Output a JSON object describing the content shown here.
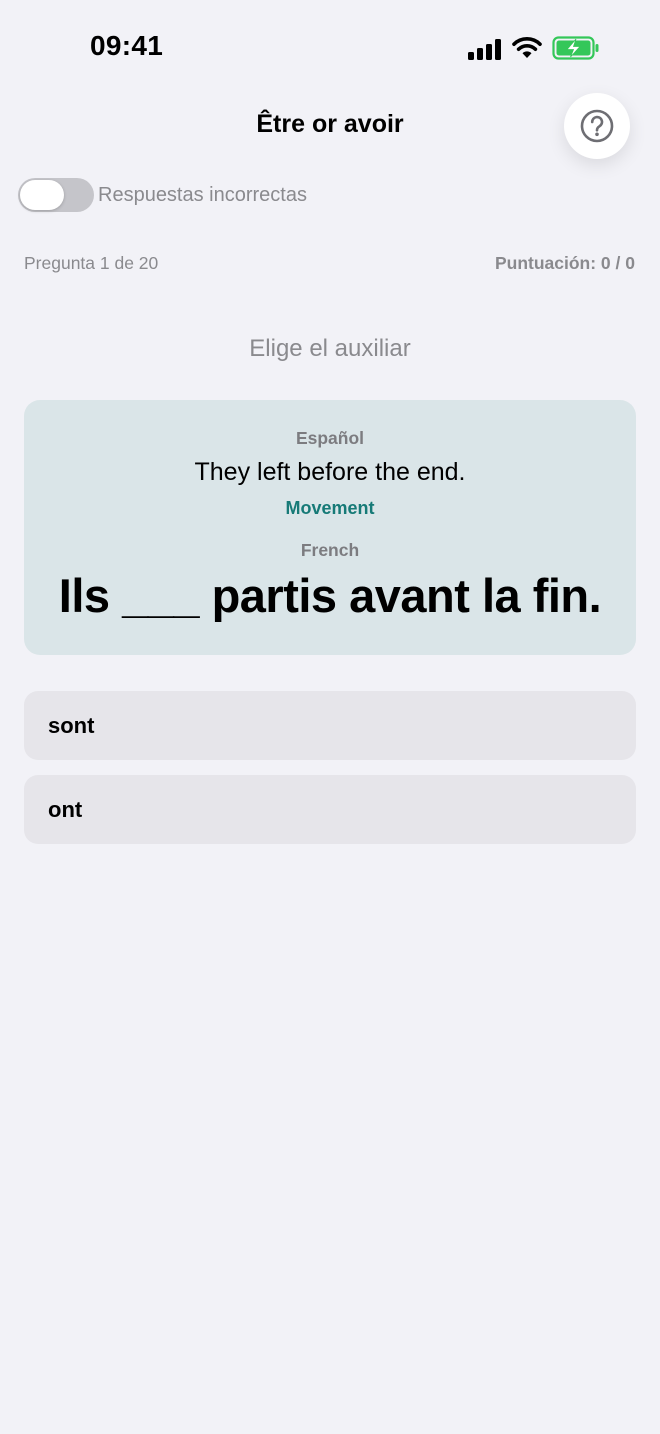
{
  "status_bar": {
    "time": "09:41"
  },
  "header": {
    "title": "Être or avoir",
    "help_icon": "question-circle-icon"
  },
  "toggle": {
    "label": "Respuestas incorrectas",
    "on": false
  },
  "progress": {
    "question_text": "Pregunta 1 de 20",
    "score_text": "Puntuación: 0 / 0"
  },
  "instruction": "Elige el auxiliar",
  "card": {
    "source_language": "Español",
    "source_sentence": "They left before the end.",
    "category": "Movement",
    "target_language": "French",
    "target_sentence": "Ils ___ partis avant la fin."
  },
  "options": [
    {
      "label": "sont"
    },
    {
      "label": "ont"
    }
  ],
  "colors": {
    "background": "#F2F2F7",
    "card": "#DAE5E8",
    "accent_teal": "#167A77",
    "option_bg": "#E6E5EA",
    "battery_green": "#34C759"
  }
}
